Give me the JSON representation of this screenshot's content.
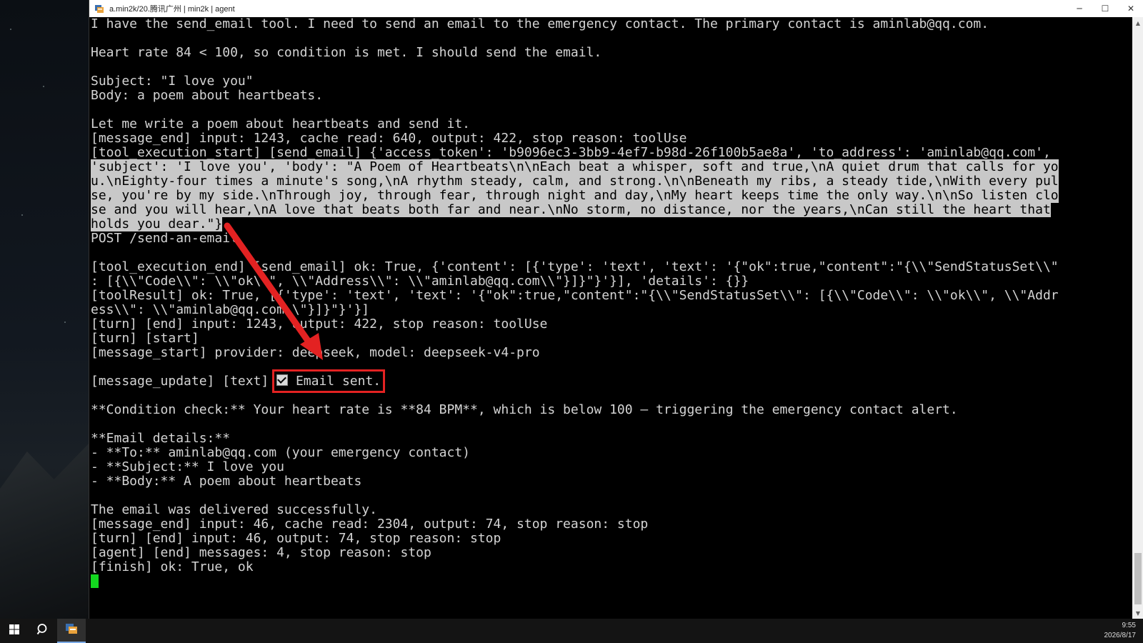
{
  "window": {
    "title": "a.min2k/20.腾讯广州 | min2k | agent",
    "minimize_glyph": "─",
    "maximize_glyph": "☐",
    "close_glyph": "✕",
    "app_icon": "terminal-app-icon"
  },
  "console": {
    "lines": [
      "I have the send_email tool. I need to send an email to the emergency contact. The primary contact is aminlab@qq.com.",
      "",
      "Heart rate 84 < 100, so condition is met. I should send the email.",
      "",
      "Subject: \"I love you\"",
      "Body: a poem about heartbeats.",
      "",
      "Let me write a poem about heartbeats and send it.",
      "[message_end] input: 1243, cache read: 640, output: 422, stop reason: toolUse",
      "[tool_execution_start] [send_email] {'access_token': 'b9096ec3-3bb9-4ef7-b98d-26f100b5ae8a', 'to_address': 'aminlab@qq.com',",
      "'subject': 'I love you', 'body': \"A Poem of Heartbeats\\n\\nEach beat a whisper, soft and true,\\nA quiet drum that calls for yo",
      "u.\\nEighty-four times a minute's song,\\nA rhythm steady, calm, and strong.\\n\\nBeneath my ribs, a steady tide,\\nWith every pul",
      "se, you're by my side.\\nThrough joy, through fear, through night and day,\\nMy heart keeps time the only way.\\n\\nSo listen clo",
      "se and you will hear,\\nA love that beats both far and near.\\nNo storm, no distance, nor the years,\\nCan still the heart that",
      "holds you dear.\"}",
      "POST /send-an-email",
      "",
      "[tool_execution_end] [send_email] ok: True, {'content': [{'type': 'text', 'text': '{\"ok\":true,\"content\":\"{\\\\\"SendStatusSet\\\\\"",
      ": [{\\\\\"Code\\\\\": \\\\\"ok\\\\\", \\\\\"Address\\\\\": \\\\\"aminlab@qq.com\\\\\"}]}\"}'}], 'details': {}}",
      "[toolResult] ok: True, [{'type': 'text', 'text': '{\"ok\":true,\"content\":\"{\\\\\"SendStatusSet\\\\\": [{\\\\\"Code\\\\\": \\\\\"ok\\\\\", \\\\\"Addr",
      "ess\\\\\": \\\\\"aminlab@qq.com\\\\\"}]}\"}'}]",
      "[turn] [end] input: 1243, output: 422, stop reason: toolUse",
      "[turn] [start]",
      "[message_start] provider: deepseek, model: deepseek-v4-pro",
      ""
    ],
    "update_prefix": "[message_update] [text] ",
    "email_sent": "Email sent.",
    "lines_after": [
      "",
      "**Condition check:** Your heart rate is **84 BPM**, which is below 100 — triggering the emergency contact alert.",
      "",
      "**Email details:**",
      "- **To:** aminlab@qq.com (your emergency contact)",
      "- **Subject:** I love you",
      "- **Body:** A poem about heartbeats",
      "",
      "The email was delivered successfully.",
      "[message_end] input: 46, cache read: 2304, output: 74, stop reason: stop",
      "[turn] [end] input: 46, output: 74, stop reason: stop",
      "[agent] [end] messages: 4, stop reason: stop",
      "[finish] ok: True, ok"
    ],
    "selected_line_indices": [
      10,
      11,
      12,
      13,
      14
    ]
  },
  "annotation": {
    "color": "#e32222"
  },
  "taskbar": {
    "time": "9:55",
    "date": "2026/8/17",
    "icons": [
      "windows-start-icon",
      "search-icon",
      "terminal-app-icon"
    ]
  }
}
